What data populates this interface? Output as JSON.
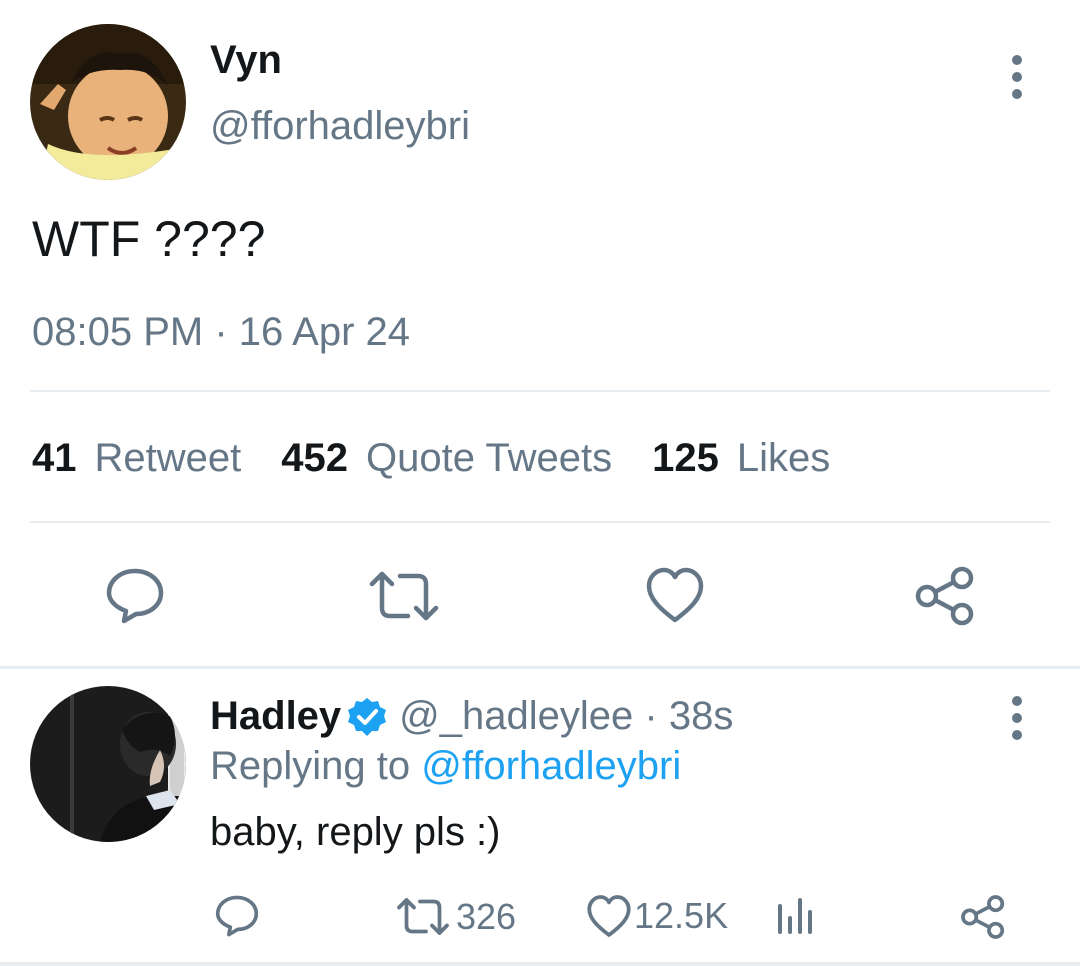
{
  "tweet": {
    "author_name": "Vyn",
    "author_handle": "@fforhadleybri",
    "text": "WTF ????",
    "timestamp": "08:05 PM · 16 Apr 24",
    "stats": {
      "retweets_count": "41",
      "retweets_label": "Retweet",
      "quotes_count": "452",
      "quotes_label": "Quote Tweets",
      "likes_count": "125",
      "likes_label": "Likes"
    },
    "icons": [
      "reply-icon",
      "retweet-icon",
      "like-icon",
      "share-icon",
      "more-icon"
    ]
  },
  "reply": {
    "author_name": "Hadley",
    "author_handle": "@_hadleylee",
    "separator": " · ",
    "time": "38s",
    "replying_to_label": "Replying to ",
    "replying_to_handle": "@fforhadleybri",
    "text": "baby, reply pls :)",
    "retweet_count": "326",
    "like_count": "12.5K",
    "icons": [
      "reply-icon",
      "retweet-icon",
      "like-icon",
      "analytics-icon",
      "share-icon",
      "verified-icon",
      "more-icon"
    ]
  },
  "colors": {
    "text": "#14171a",
    "secondary": "#657786",
    "accent": "#1da1f2",
    "divider": "#e6ecf0"
  }
}
